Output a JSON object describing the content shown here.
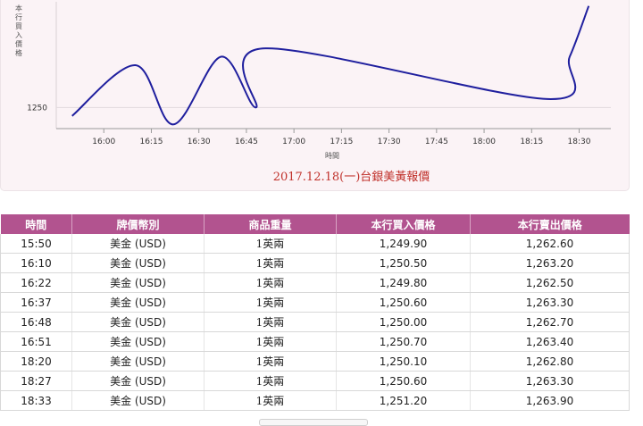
{
  "chart_data": {
    "type": "line",
    "title": "",
    "caption": "2017.12.18(一)台銀美黃報價",
    "xlabel": "時間",
    "ylabel": "本行買入價格",
    "x_ticks": [
      "16:00",
      "16:15",
      "16:30",
      "16:45",
      "17:00",
      "17:15",
      "17:30",
      "17:45",
      "18:00",
      "18:15",
      "18:30"
    ],
    "y_ticks": [
      1250
    ],
    "grid": true,
    "legend": "none",
    "line_color": "#1f1f9e",
    "x": [
      "15:50",
      "16:10",
      "16:22",
      "16:37",
      "16:48",
      "16:51",
      "18:20",
      "18:27",
      "18:33"
    ],
    "series": [
      {
        "values": [
          1249.9,
          1250.5,
          1249.8,
          1250.6,
          1250.0,
          1250.7,
          1250.1,
          1250.6,
          1251.2
        ]
      }
    ]
  },
  "table": {
    "headers": [
      "時間",
      "牌價幣別",
      "商品重量",
      "本行買入價格",
      "本行賣出價格"
    ],
    "rows": [
      [
        "15:50",
        "美金 (USD)",
        "1英兩",
        "1,249.90",
        "1,262.60"
      ],
      [
        "16:10",
        "美金 (USD)",
        "1英兩",
        "1,250.50",
        "1,263.20"
      ],
      [
        "16:22",
        "美金 (USD)",
        "1英兩",
        "1,249.80",
        "1,262.50"
      ],
      [
        "16:37",
        "美金 (USD)",
        "1英兩",
        "1,250.60",
        "1,263.30"
      ],
      [
        "16:48",
        "美金 (USD)",
        "1英兩",
        "1,250.00",
        "1,262.70"
      ],
      [
        "16:51",
        "美金 (USD)",
        "1英兩",
        "1,250.70",
        "1,263.40"
      ],
      [
        "18:20",
        "美金 (USD)",
        "1英兩",
        "1,250.10",
        "1,262.80"
      ],
      [
        "18:27",
        "美金 (USD)",
        "1英兩",
        "1,250.60",
        "1,263.30"
      ],
      [
        "18:33",
        "美金 (USD)",
        "1英兩",
        "1,251.20",
        "1,263.90"
      ]
    ]
  }
}
